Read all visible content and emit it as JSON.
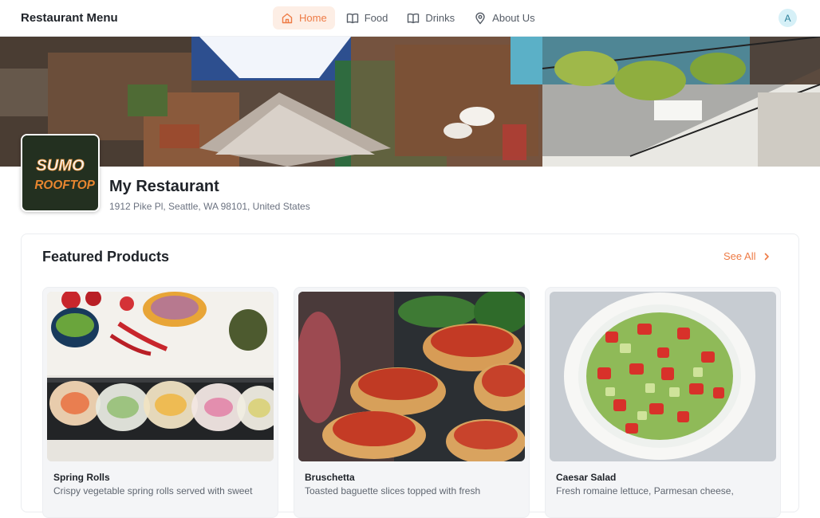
{
  "app": {
    "brand": "Restaurant Menu",
    "avatar_initial": "A",
    "accent": "#ee7b45"
  },
  "nav": [
    {
      "label": "Home",
      "icon": "home-icon",
      "active": true
    },
    {
      "label": "Food",
      "icon": "book-icon",
      "active": false
    },
    {
      "label": "Drinks",
      "icon": "book-icon",
      "active": false
    },
    {
      "label": "About Us",
      "icon": "map-pin-icon",
      "active": false
    }
  ],
  "restaurant": {
    "name": "My Restaurant",
    "address": "1912 Pike Pl, Seattle, WA 98101, United States",
    "logo_text": [
      "SUMO",
      "ROOFTOP"
    ]
  },
  "featured": {
    "title": "Featured Products",
    "see_all": "See All",
    "items": [
      {
        "title": "Spring Rolls",
        "description": "Crispy vegetable spring rolls served with sweet"
      },
      {
        "title": "Bruschetta",
        "description": "Toasted baguette slices topped with fresh"
      },
      {
        "title": "Caesar Salad",
        "description": "Fresh romaine lettuce, Parmesan cheese,"
      }
    ]
  }
}
